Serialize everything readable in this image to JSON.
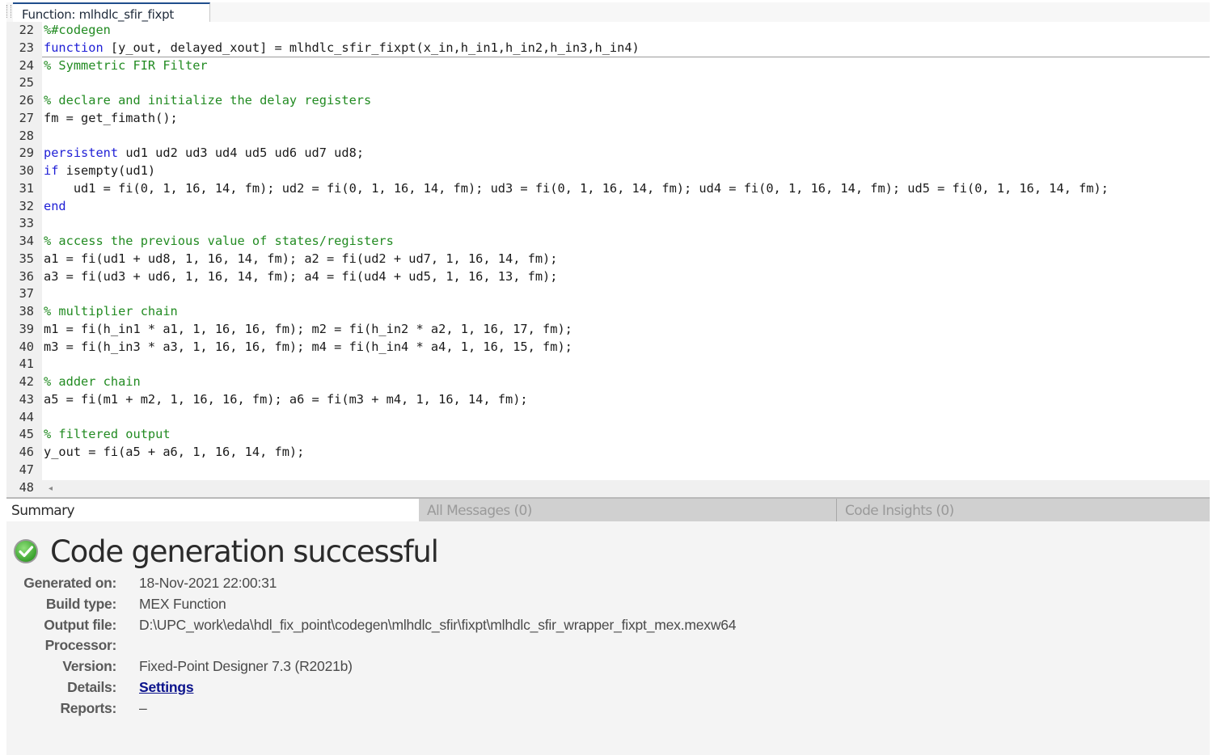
{
  "editor": {
    "tab_label": "Function: mlhdlc_sfir_fixpt",
    "lines": [
      {
        "n": "22",
        "html": "<span class=\"cm\">%#codegen</span>"
      },
      {
        "n": "23",
        "html": "<span class=\"kw\">function</span> [y_out, delayed_xout] = mlhdlc_sfir_fixpt(x_in,h_in1,h_in2,h_in3,h_in4)",
        "cursor": true
      },
      {
        "n": "24",
        "html": "<span class=\"cm\">% Symmetric FIR Filter</span>"
      },
      {
        "n": "25",
        "html": ""
      },
      {
        "n": "26",
        "html": "<span class=\"cm\">% declare and initialize the delay registers</span>"
      },
      {
        "n": "27",
        "html": "fm = get_fimath();"
      },
      {
        "n": "28",
        "html": ""
      },
      {
        "n": "29",
        "html": "<span class=\"kw\">persistent</span> ud1 ud2 ud3 ud4 ud5 ud6 ud7 ud8;"
      },
      {
        "n": "30",
        "html": "<span class=\"kw\">if</span> isempty(ud1)"
      },
      {
        "n": "31",
        "html": "    ud1 = fi(0, 1, 16, 14, fm); ud2 = fi(0, 1, 16, 14, fm); ud3 = fi(0, 1, 16, 14, fm); ud4 = fi(0, 1, 16, 14, fm); ud5 = fi(0, 1, 16, 14, fm);"
      },
      {
        "n": "32",
        "html": "<span class=\"kw\">end</span>"
      },
      {
        "n": "33",
        "html": ""
      },
      {
        "n": "34",
        "html": "<span class=\"cm\">% access the previous value of states/registers</span>"
      },
      {
        "n": "35",
        "html": "a1 = fi(ud1 + ud8, 1, 16, 14, fm); a2 = fi(ud2 + ud7, 1, 16, 14, fm);"
      },
      {
        "n": "36",
        "html": "a3 = fi(ud3 + ud6, 1, 16, 14, fm); a4 = fi(ud4 + ud5, 1, 16, 13, fm);"
      },
      {
        "n": "37",
        "html": ""
      },
      {
        "n": "38",
        "html": "<span class=\"cm\">% multiplier chain</span>"
      },
      {
        "n": "39",
        "html": "m1 = fi(h_in1 * a1, 1, 16, 16, fm); m2 = fi(h_in2 * a2, 1, 16, 17, fm);"
      },
      {
        "n": "40",
        "html": "m3 = fi(h_in3 * a3, 1, 16, 16, fm); m4 = fi(h_in4 * a4, 1, 16, 15, fm);"
      },
      {
        "n": "41",
        "html": ""
      },
      {
        "n": "42",
        "html": "<span class=\"cm\">% adder chain</span>"
      },
      {
        "n": "43",
        "html": "a5 = fi(m1 + m2, 1, 16, 16, fm); a6 = fi(m3 + m4, 1, 16, 14, fm);"
      },
      {
        "n": "44",
        "html": ""
      },
      {
        "n": "45",
        "html": "<span class=\"cm\">% filtered output</span>"
      },
      {
        "n": "46",
        "html": "y_out = fi(a5 + a6, 1, 16, 14, fm);"
      },
      {
        "n": "47",
        "html": ""
      },
      {
        "n": "48",
        "html": ""
      }
    ],
    "scroll_left_icon": "◂"
  },
  "report_tabs": [
    {
      "label": "Summary",
      "active": true
    },
    {
      "label": "All Messages (0)",
      "active": false
    },
    {
      "label": "Code Insights (0)",
      "active": false
    }
  ],
  "summary": {
    "status_icon": "check-circle-icon",
    "status_color": "#4caf3a",
    "title": "Code generation successful",
    "properties": [
      {
        "key": "Generated on:",
        "value": "18-Nov-2021 22:00:31"
      },
      {
        "key": "Build type:",
        "value": "MEX Function"
      },
      {
        "key": "Output file:",
        "value": "D:\\UPC_work\\eda\\hdl_fix_point\\codegen\\mlhdlc_sfir\\fixpt\\mlhdlc_sfir_wrapper_fixpt_mex.mexw64"
      },
      {
        "key": "Processor:",
        "value": ""
      },
      {
        "key": "Version:",
        "value": "Fixed-Point Designer 7.3 (R2021b)"
      },
      {
        "key": "Details:",
        "value": "Settings",
        "link": true
      },
      {
        "key": "Reports:",
        "value": "–"
      }
    ]
  }
}
